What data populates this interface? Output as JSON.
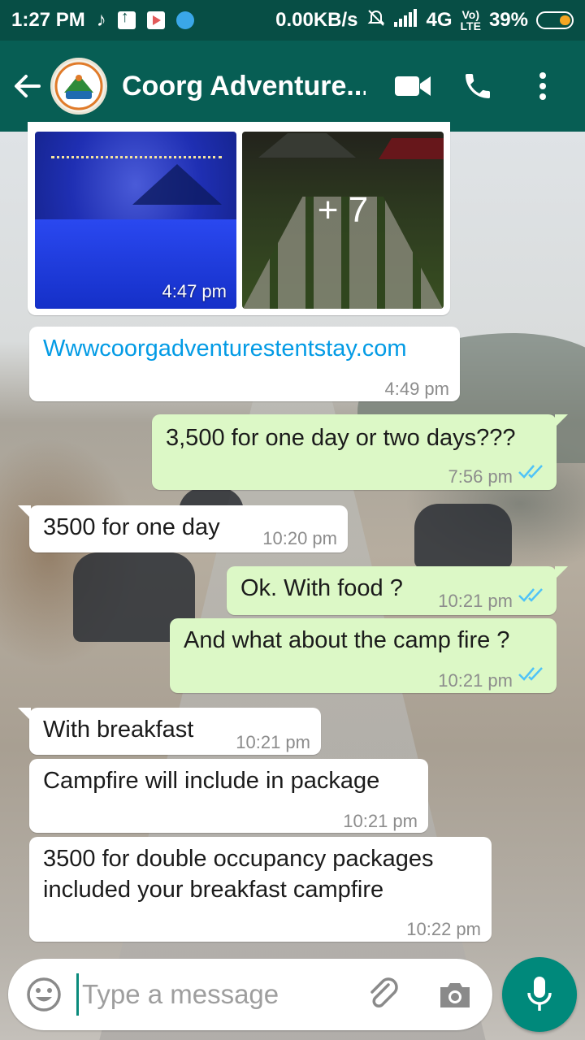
{
  "status_bar": {
    "time": "1:27 PM",
    "speed": "0.00KB/s",
    "network": "4G",
    "lte": "LTE",
    "battery": "39%",
    "battery_level": 0.39
  },
  "header": {
    "title": "Coorg Adventure...",
    "avatar_icon": "coorg-adventures-logo"
  },
  "media": {
    "more_count": "+ 7",
    "time": "4:47 pm"
  },
  "messages": [
    {
      "direction": "in",
      "text": "Wwwcoorgadventurestentstay.com",
      "time": "4:49 pm",
      "is_link": true
    },
    {
      "direction": "out",
      "text": "3,500 for one day or two days???",
      "time": "7:56 pm",
      "status": "read"
    },
    {
      "direction": "in",
      "text": "3500 for one day",
      "time": "10:20 pm"
    },
    {
      "direction": "out",
      "text": "Ok.  With food ?",
      "time": "10:21 pm",
      "status": "read"
    },
    {
      "direction": "out",
      "text": "And what about the camp fire ?",
      "time": "10:21 pm",
      "status": "read"
    },
    {
      "direction": "in",
      "text": "With breakfast",
      "time": "10:21 pm"
    },
    {
      "direction": "in",
      "text": "Campfire will include in package",
      "time": "10:21 pm"
    },
    {
      "direction": "in",
      "text_lines": [
        "3500 for double occupancy packages",
        "included your breakfast campfire"
      ],
      "time": "10:22 pm"
    }
  ],
  "composer": {
    "placeholder": "Type a message"
  },
  "colors": {
    "header": "#075e54",
    "status_bar": "#074e45",
    "outgoing_bubble": "#dcf8c6",
    "incoming_bubble": "#ffffff",
    "link": "#039be5",
    "read_ticks": "#4fc3f7",
    "mic_button": "#00897b"
  }
}
